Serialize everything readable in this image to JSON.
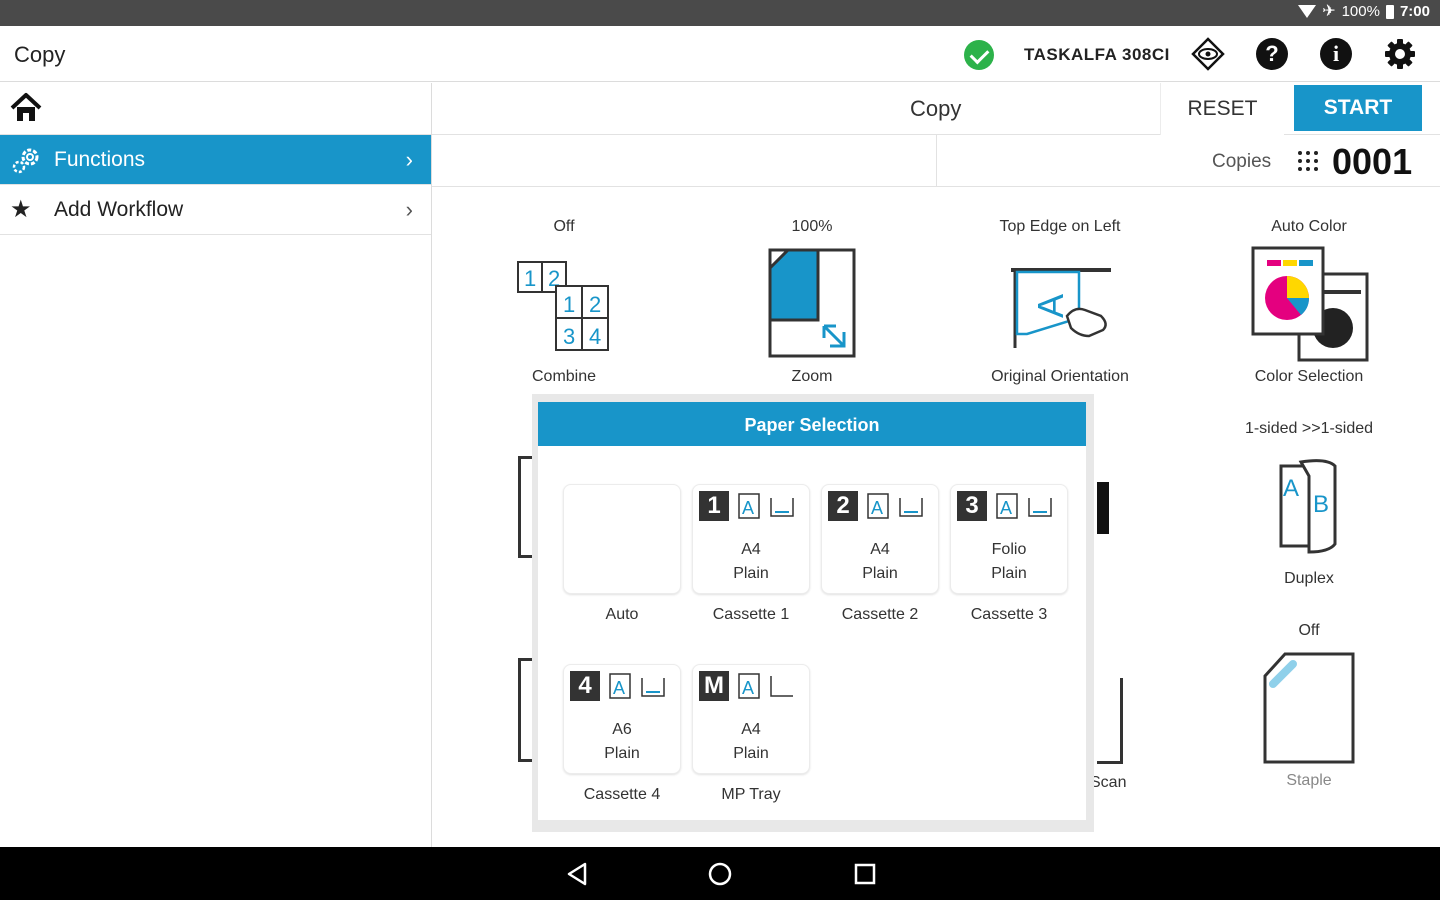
{
  "status_bar": {
    "battery": "100%",
    "time": "7:00"
  },
  "app": {
    "title": "Copy",
    "device_name": "TASKALFA 308CI"
  },
  "sidebar": {
    "items": [
      {
        "label": "Functions",
        "active": true
      },
      {
        "label": "Add Workflow",
        "active": false
      }
    ]
  },
  "toolbar": {
    "mode": "Copy",
    "reset_label": "RESET",
    "start_label": "START"
  },
  "copies": {
    "label": "Copies",
    "count": "0001"
  },
  "functions": [
    {
      "value": "Off",
      "label": "Combine"
    },
    {
      "value": "100%",
      "label": "Zoom"
    },
    {
      "value": "Top Edge on Left",
      "label": "Original Orientation"
    },
    {
      "value": "Auto Color",
      "label": "Color Selection"
    },
    {
      "value": "1-sided >>1-sided",
      "label": "Duplex"
    },
    {
      "value": "Off",
      "label": "Staple"
    },
    {
      "label": "Scan"
    }
  ],
  "paper_selection": {
    "title": "Paper Selection",
    "trays": [
      {
        "num": "",
        "size": "",
        "type": "",
        "name": "Auto"
      },
      {
        "num": "1",
        "size": "A4",
        "type": "Plain",
        "name": "Cassette 1"
      },
      {
        "num": "2",
        "size": "A4",
        "type": "Plain",
        "name": "Cassette 2"
      },
      {
        "num": "3",
        "size": "Folio",
        "type": "Plain",
        "name": "Cassette 3"
      },
      {
        "num": "4",
        "size": "A6",
        "type": "Plain",
        "name": "Cassette 4"
      },
      {
        "num": "M",
        "size": "A4",
        "type": "Plain",
        "name": "MP Tray"
      }
    ]
  },
  "colors": {
    "accent": "#1895c9",
    "ok": "#2db24a"
  }
}
